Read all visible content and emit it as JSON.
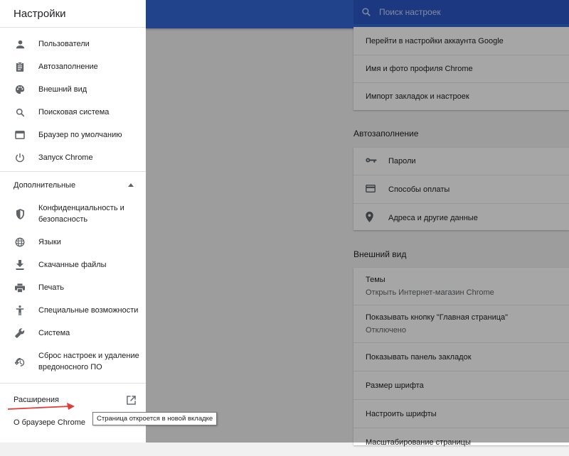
{
  "sidebar": {
    "title": "Настройки",
    "items": [
      {
        "label": "Пользователи",
        "icon": "person-icon"
      },
      {
        "label": "Автозаполнение",
        "icon": "clipboard-icon"
      },
      {
        "label": "Внешний вид",
        "icon": "palette-icon"
      },
      {
        "label": "Поисковая система",
        "icon": "search-icon"
      },
      {
        "label": "Браузер по умолчанию",
        "icon": "browser-window-icon"
      },
      {
        "label": "Запуск Chrome",
        "icon": "power-icon"
      }
    ],
    "advanced_label": "Дополнительные",
    "advanced_items": [
      {
        "label_line1": "Конфиденциальность и",
        "label_line2": "безопасность",
        "icon": "shield-icon"
      },
      {
        "label_line1": "Языки",
        "label_line2": "",
        "icon": "globe-icon"
      },
      {
        "label_line1": "Скачанные файлы",
        "label_line2": "",
        "icon": "download-icon"
      },
      {
        "label_line1": "Печать",
        "label_line2": "",
        "icon": "printer-icon"
      },
      {
        "label_line1": "Специальные возможности",
        "label_line2": "",
        "icon": "accessibility-icon"
      },
      {
        "label_line1": "Система",
        "label_line2": "",
        "icon": "wrench-icon"
      },
      {
        "label_line1": "Сброс настроек и удаление",
        "label_line2": "вредоносного ПО",
        "icon": "history-icon"
      }
    ],
    "extensions_label": "Расширения",
    "about_label": "О браузере Chrome"
  },
  "search": {
    "placeholder": "Поиск настроек"
  },
  "main": {
    "people_rows": [
      "Перейти в настройки аккаунта Google",
      "Имя и фото профиля Chrome",
      "Импорт закладок и настроек"
    ],
    "autofill_title": "Автозаполнение",
    "autofill_rows": [
      {
        "label": "Пароли",
        "icon": "key-icon"
      },
      {
        "label": "Способы оплаты",
        "icon": "credit-card-icon"
      },
      {
        "label": "Адреса и другие данные",
        "icon": "location-pin-icon"
      }
    ],
    "appearance_title": "Внешний вид",
    "appearance_rows": [
      {
        "label": "Темы",
        "sub": "Открыть Интернет-магазин Chrome"
      },
      {
        "label": "Показывать кнопку \"Главная страница\"",
        "sub": "Отключено"
      },
      {
        "label": "Показывать панель закладок",
        "sub": ""
      },
      {
        "label": "Размер шрифта",
        "sub": ""
      },
      {
        "label": "Настроить шрифты",
        "sub": ""
      },
      {
        "label": "Масштабирование страницы",
        "sub": ""
      }
    ]
  },
  "tooltip": "Страница откроется в новой вкладке",
  "colors": {
    "topbar": "#3367d6",
    "annotation_arrow": "#e53935"
  }
}
